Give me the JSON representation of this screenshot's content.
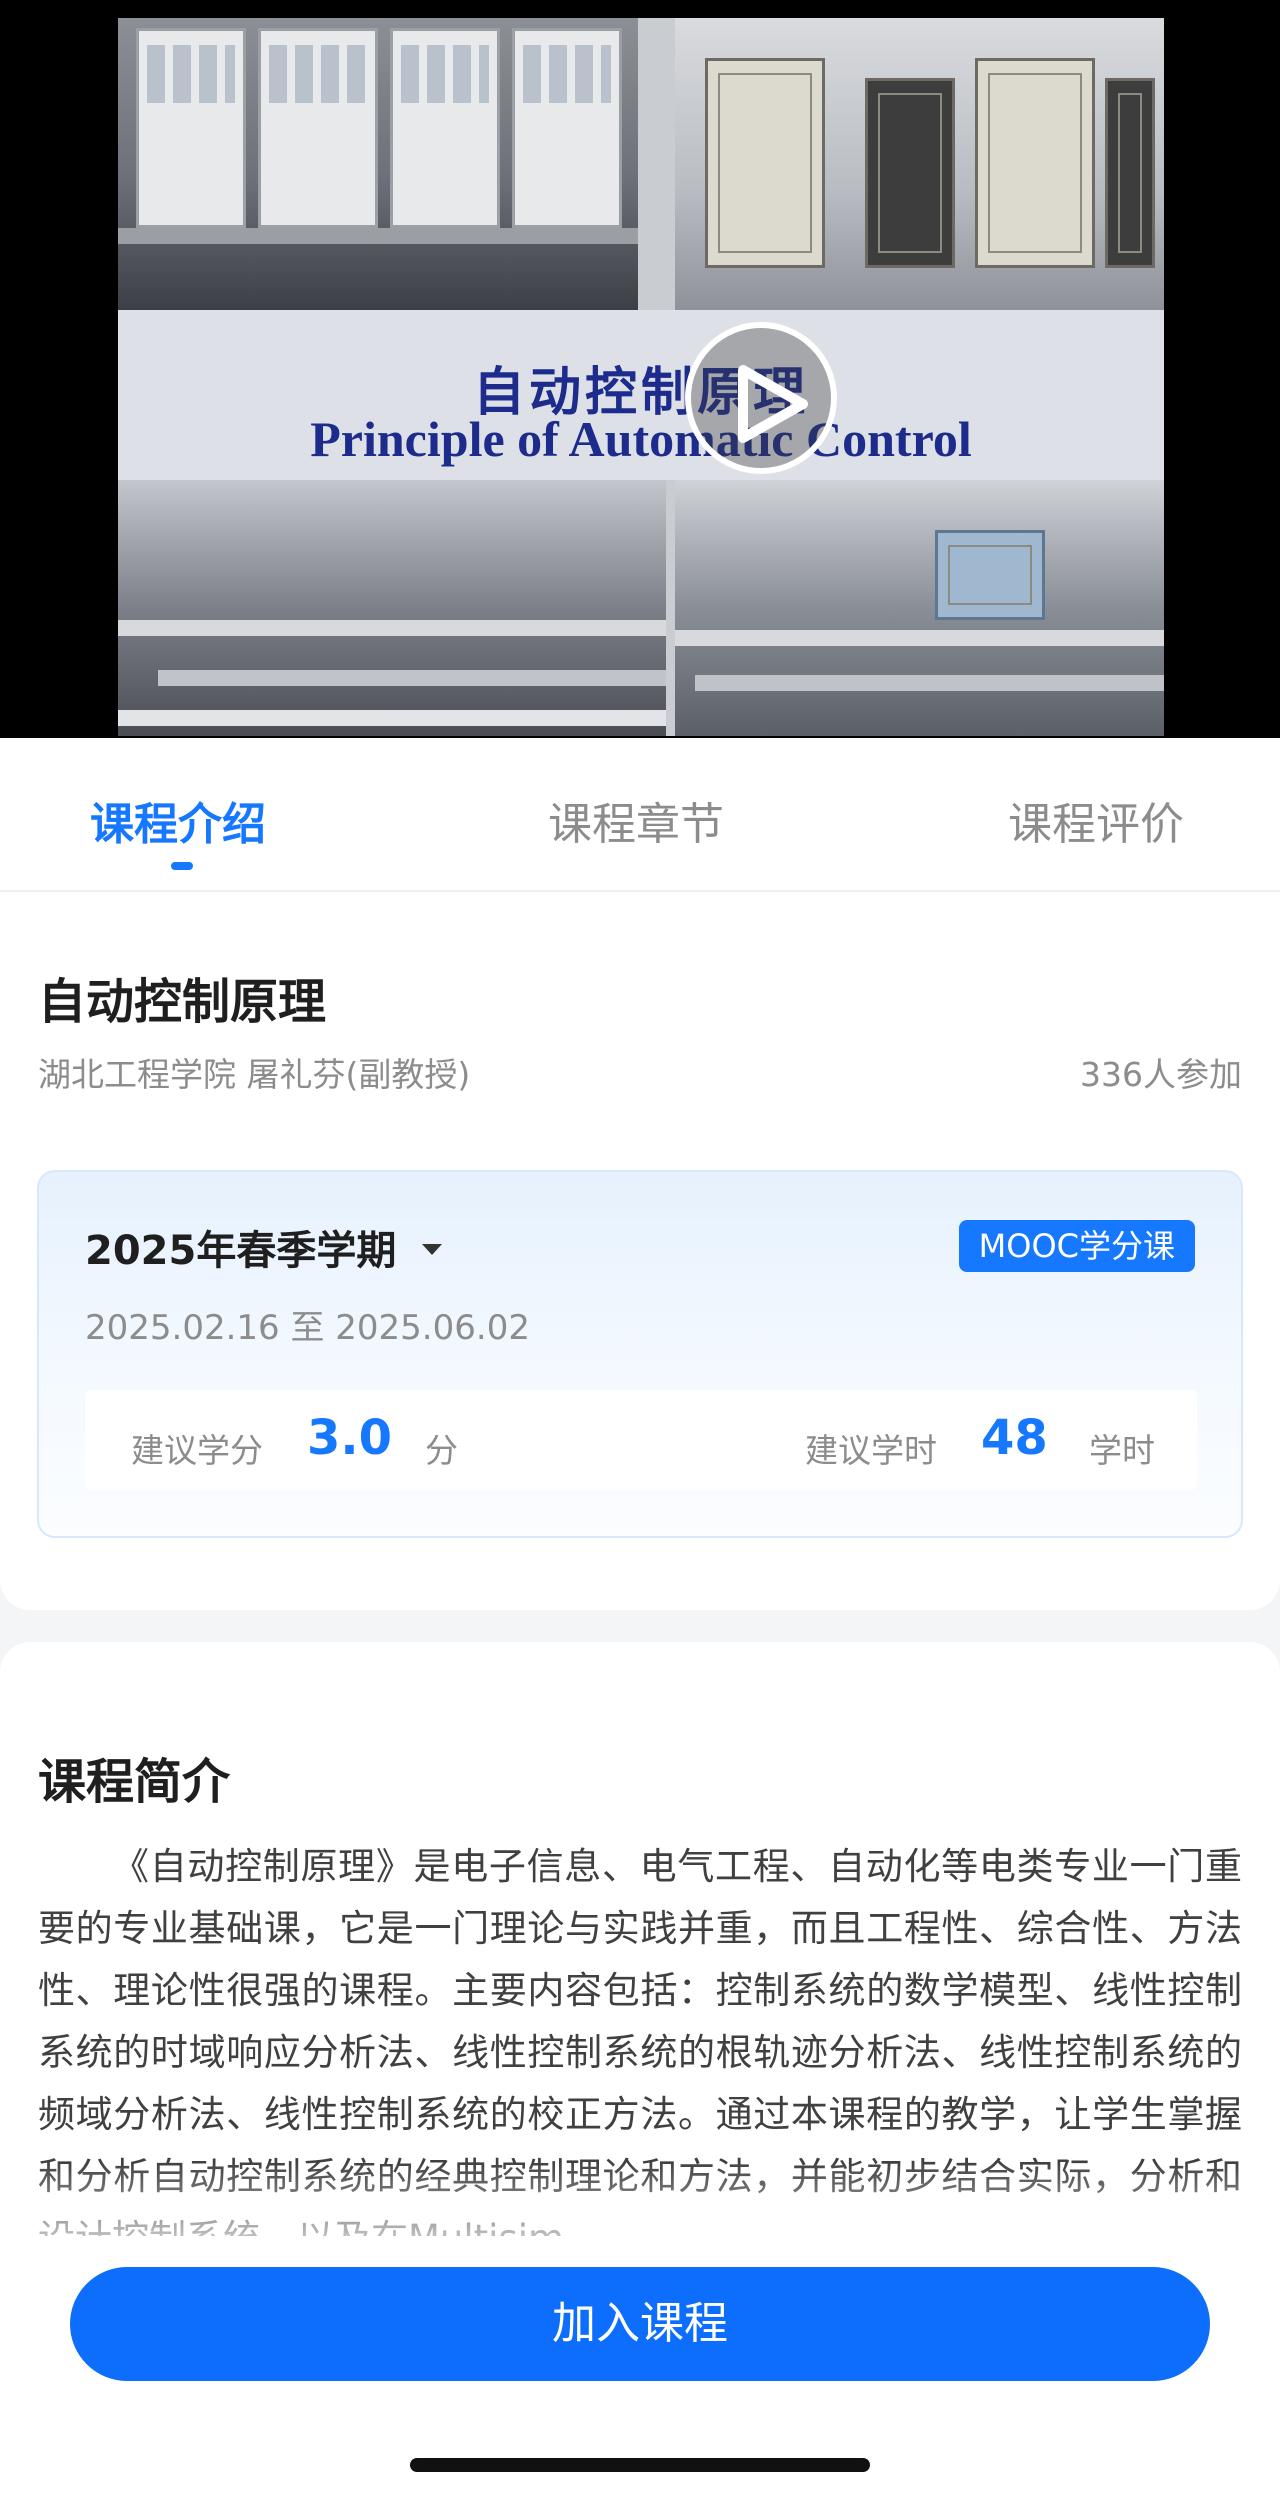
{
  "video": {
    "slide_title_cn": "自动控制原理",
    "slide_title_en": "Principle of Automatic Control",
    "play_icon": "play-icon"
  },
  "tabs": [
    {
      "label": "课程介绍",
      "active": true
    },
    {
      "label": "课程章节",
      "active": false
    },
    {
      "label": "课程评价",
      "active": false
    }
  ],
  "course": {
    "title": "自动控制原理",
    "meta": "湖北工程学院 屠礼芬(副教授)",
    "participants": "336人参加"
  },
  "term": {
    "name": "2025年春季学期",
    "badge": "MOOC学分课",
    "dates": "2025.02.16 至 2025.06.02",
    "credit_label": "建议学分",
    "credit_value": "3.0",
    "credit_unit": "分",
    "hours_label": "建议学时",
    "hours_value": "48",
    "hours_unit": "学时"
  },
  "intro": {
    "heading": "课程简介",
    "text": "《自动控制原理》是电子信息、电气工程、自动化等电类专业一门重要的专业基础课，它是一门理论与实践并重，而且工程性、综合性、方法性、理论性很强的课程。主要内容包括：控制系统的数学模型、线性控制系统的时域响应分析法、线性控制系统的根轨迹分析法、线性控制系统的频域分析法、线性控制系统的校正方法。通过本课程的教学，让学生掌握和分析自动控制系统的经典控制理论和方法，并能初步结合实际，分析和设计控制系统，以及在Multisim"
  },
  "join_button": "加入课程",
  "colors": {
    "accent": "#1677ff",
    "button": "#0d6efd",
    "muted_text": "#8c8c8c"
  }
}
